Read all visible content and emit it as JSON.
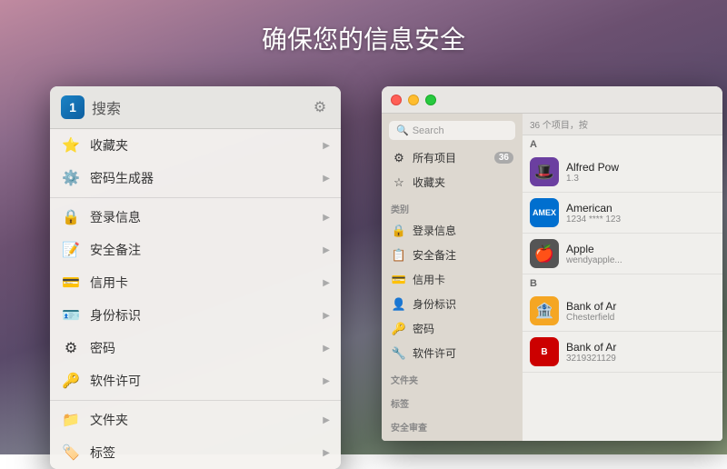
{
  "page": {
    "title": "确保您的信息安全",
    "bg_gradient": "mountain"
  },
  "dropdown": {
    "logo_text": "1",
    "search_placeholder": "搜索",
    "gear_label": "设置",
    "items": [
      {
        "id": "favorites",
        "icon": "⭐",
        "label": "收藏夹",
        "has_arrow": true
      },
      {
        "id": "password-gen",
        "icon": "⚙️",
        "label": "密码生成器",
        "has_arrow": true
      },
      {
        "id": "divider1"
      },
      {
        "id": "logins",
        "icon": "🔒",
        "label": "登录信息",
        "has_arrow": true
      },
      {
        "id": "secure-notes",
        "icon": "📝",
        "label": "安全备注",
        "has_arrow": true
      },
      {
        "id": "credit-cards",
        "icon": "💳",
        "label": "信用卡",
        "has_arrow": true
      },
      {
        "id": "identity",
        "icon": "🪪",
        "label": "身份标识",
        "has_arrow": true
      },
      {
        "id": "passwords",
        "icon": "⚙",
        "label": "密码",
        "has_arrow": true
      },
      {
        "id": "software",
        "icon": "🔑",
        "label": "软件许可",
        "has_arrow": true
      },
      {
        "id": "divider2"
      },
      {
        "id": "folders",
        "icon": "📁",
        "label": "文件夹",
        "has_arrow": true
      },
      {
        "id": "tags",
        "icon": "🏷️",
        "label": "标签",
        "has_arrow": true
      }
    ]
  },
  "main_window": {
    "sidebar": {
      "search_placeholder": "Search",
      "items_top": [
        {
          "id": "all",
          "icon": "⚙",
          "label": "所有项目",
          "badge": "36"
        },
        {
          "id": "favorites",
          "icon": "☆",
          "label": "收藏夹"
        }
      ],
      "section_category": "类别",
      "items_category": [
        {
          "id": "logins",
          "icon": "🔒",
          "label": "登录信息"
        },
        {
          "id": "secure-notes",
          "icon": "📋",
          "label": "安全备注"
        },
        {
          "id": "credit-cards",
          "icon": "💳",
          "label": "信用卡"
        },
        {
          "id": "identity",
          "icon": "👤",
          "label": "身份标识"
        },
        {
          "id": "passwords",
          "icon": "🔑",
          "label": "密码"
        },
        {
          "id": "software",
          "icon": "🔧",
          "label": "软件许可"
        }
      ],
      "section_folders": "文件夹",
      "section_tags": "标签",
      "section_audit": "安全审查"
    },
    "content": {
      "header_text": "36 个项目，按",
      "sections": [
        {
          "letter": "A",
          "items": [
            {
              "id": "alfred",
              "name": "Alfred Pow",
              "sub": "1.3",
              "icon_type": "alfred"
            },
            {
              "id": "amex",
              "name": "American",
              "sub": "1234 **** 123",
              "icon_type": "amex"
            },
            {
              "id": "apple",
              "name": "Apple",
              "sub": "wendyapple...",
              "icon_type": "apple"
            }
          ]
        },
        {
          "letter": "B",
          "items": [
            {
              "id": "bank1",
              "name": "Bank of Ar",
              "sub": "Chesterfield",
              "icon_type": "bank1"
            },
            {
              "id": "bank2",
              "name": "Bank of Ar",
              "sub": "3219321129",
              "icon_type": "bank2"
            }
          ]
        }
      ]
    }
  }
}
